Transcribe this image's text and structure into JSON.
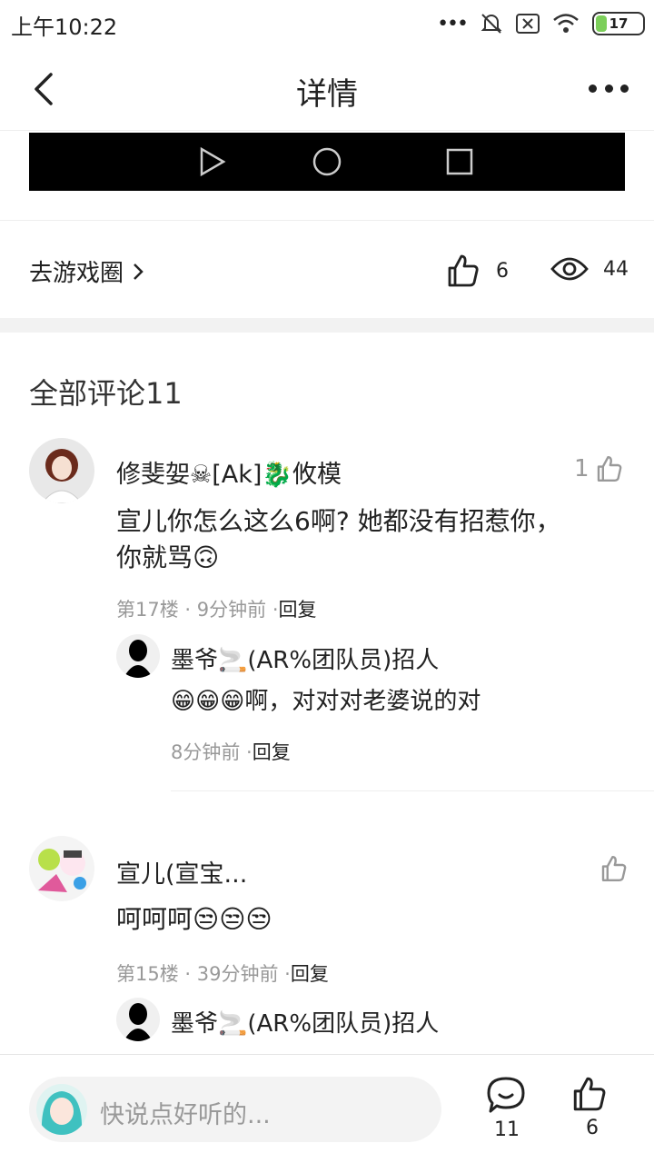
{
  "status": {
    "time": "上午10:22",
    "battery": "17"
  },
  "header": {
    "title": "详情"
  },
  "post": {
    "go_circle": "去游戏圈",
    "likes": "6",
    "views": "44"
  },
  "comments": {
    "title": "全部评论11",
    "items": [
      {
        "name": "修斐妿☠[Ak]🐉攸模",
        "likes": "1",
        "body_line1": "宣儿你怎么这么6啊? 她都没有招惹你，",
        "body_line2": "你就骂🙃",
        "floor": "第17楼",
        "time": "9分钟前",
        "reply_label": "回复",
        "reply": {
          "name": "墨爷🚬(AR%团队员)招人",
          "body": "😁😁😁啊，对对对老婆说的对",
          "time": "8分钟前",
          "reply_label": "回复"
        }
      },
      {
        "name": "宣儿(宣宝...",
        "likes": "",
        "body_line1": "呵呵呵😒😒😒",
        "floor": "第15楼",
        "time": "39分钟前",
        "reply_label": "回复",
        "reply": {
          "name": "墨爷🚬(AR%团队员)招人"
        }
      }
    ]
  },
  "bottom": {
    "placeholder": "快说点好听的...",
    "comment_count": "11",
    "like_count": "6"
  },
  "colors": {
    "divider": "#eeeeee",
    "muted": "#999999",
    "battery_fill": "#7ccf5a"
  }
}
